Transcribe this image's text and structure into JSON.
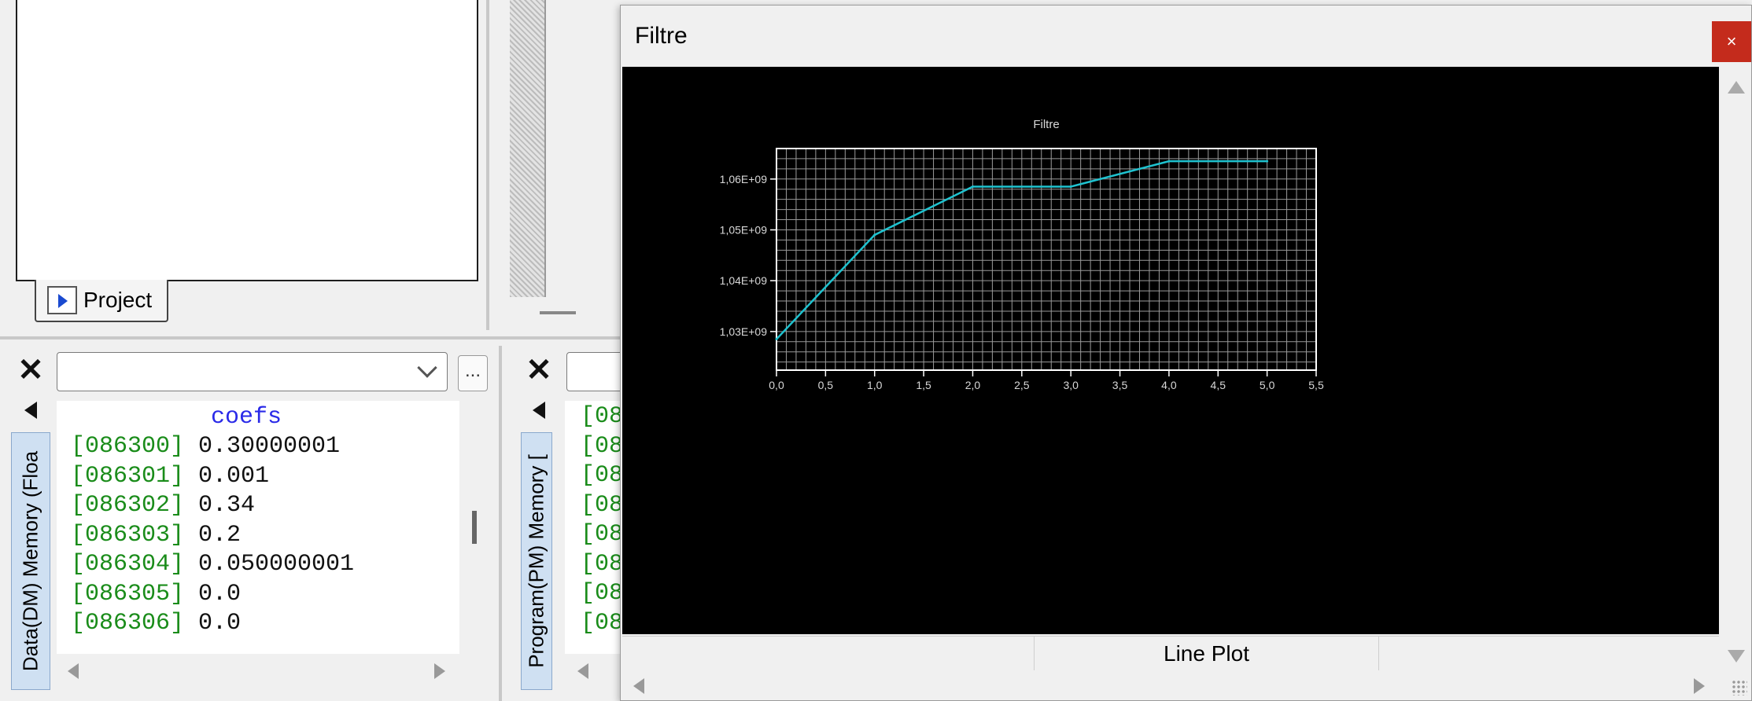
{
  "project": {
    "tab_label": "Project"
  },
  "dm_panel": {
    "side_label": "Data(DM) Memory (Floa",
    "dots_label": "...",
    "header": "coefs",
    "rows": [
      {
        "addr": "[086300]",
        "val": "0.30000001"
      },
      {
        "addr": "[086301]",
        "val": "0.001"
      },
      {
        "addr": "[086302]",
        "val": "0.34"
      },
      {
        "addr": "[086303]",
        "val": "0.2"
      },
      {
        "addr": "[086304]",
        "val": "0.050000001"
      },
      {
        "addr": "[086305]",
        "val": "0.0"
      },
      {
        "addr": "[086306]",
        "val": "0.0"
      }
    ]
  },
  "pm_panel": {
    "side_label": "Program(PM) Memory [",
    "rows": [
      {
        "addr": "[08"
      },
      {
        "addr": "[08"
      },
      {
        "addr": "[08"
      },
      {
        "addr": "[08"
      },
      {
        "addr": "[08"
      },
      {
        "addr": "[08"
      },
      {
        "addr": "[08"
      },
      {
        "addr": "[08"
      }
    ]
  },
  "window": {
    "title": "Filtre",
    "close_glyph": "×",
    "status": {
      "left": "",
      "center": "Line Plot",
      "right": ""
    }
  },
  "chart_data": {
    "type": "line",
    "title": "Filtre",
    "xlabel": "",
    "ylabel": "",
    "x": [
      0.0,
      1.0,
      2.0,
      3.0,
      4.0,
      5.0
    ],
    "series": [
      {
        "values": [
          1028500000,
          1049000000,
          1058500000,
          1058500000,
          1063500000,
          1063500000
        ],
        "color": "#1fc2cf"
      }
    ],
    "xlim": [
      0.0,
      5.5
    ],
    "ylim": [
      1022400000,
      1066000000
    ],
    "x_ticks": [
      0.0,
      0.5,
      1.0,
      1.5,
      2.0,
      2.5,
      3.0,
      3.5,
      4.0,
      4.5,
      5.0,
      5.5
    ],
    "x_tick_labels": [
      "0,0",
      "0,5",
      "1,0",
      "1,5",
      "2,0",
      "2,5",
      "3,0",
      "3,5",
      "4,0",
      "4,5",
      "5,0",
      "5,5"
    ],
    "y_ticks": [
      1030000000,
      1040000000,
      1050000000,
      1060000000
    ],
    "y_tick_labels": [
      "1,03E+09",
      "1,04E+09",
      "1,05E+09",
      "1,06E+09"
    ],
    "grid": true,
    "background": "#000000",
    "grid_color": "#9a9a9a",
    "text_color": "#d8d8d8"
  }
}
